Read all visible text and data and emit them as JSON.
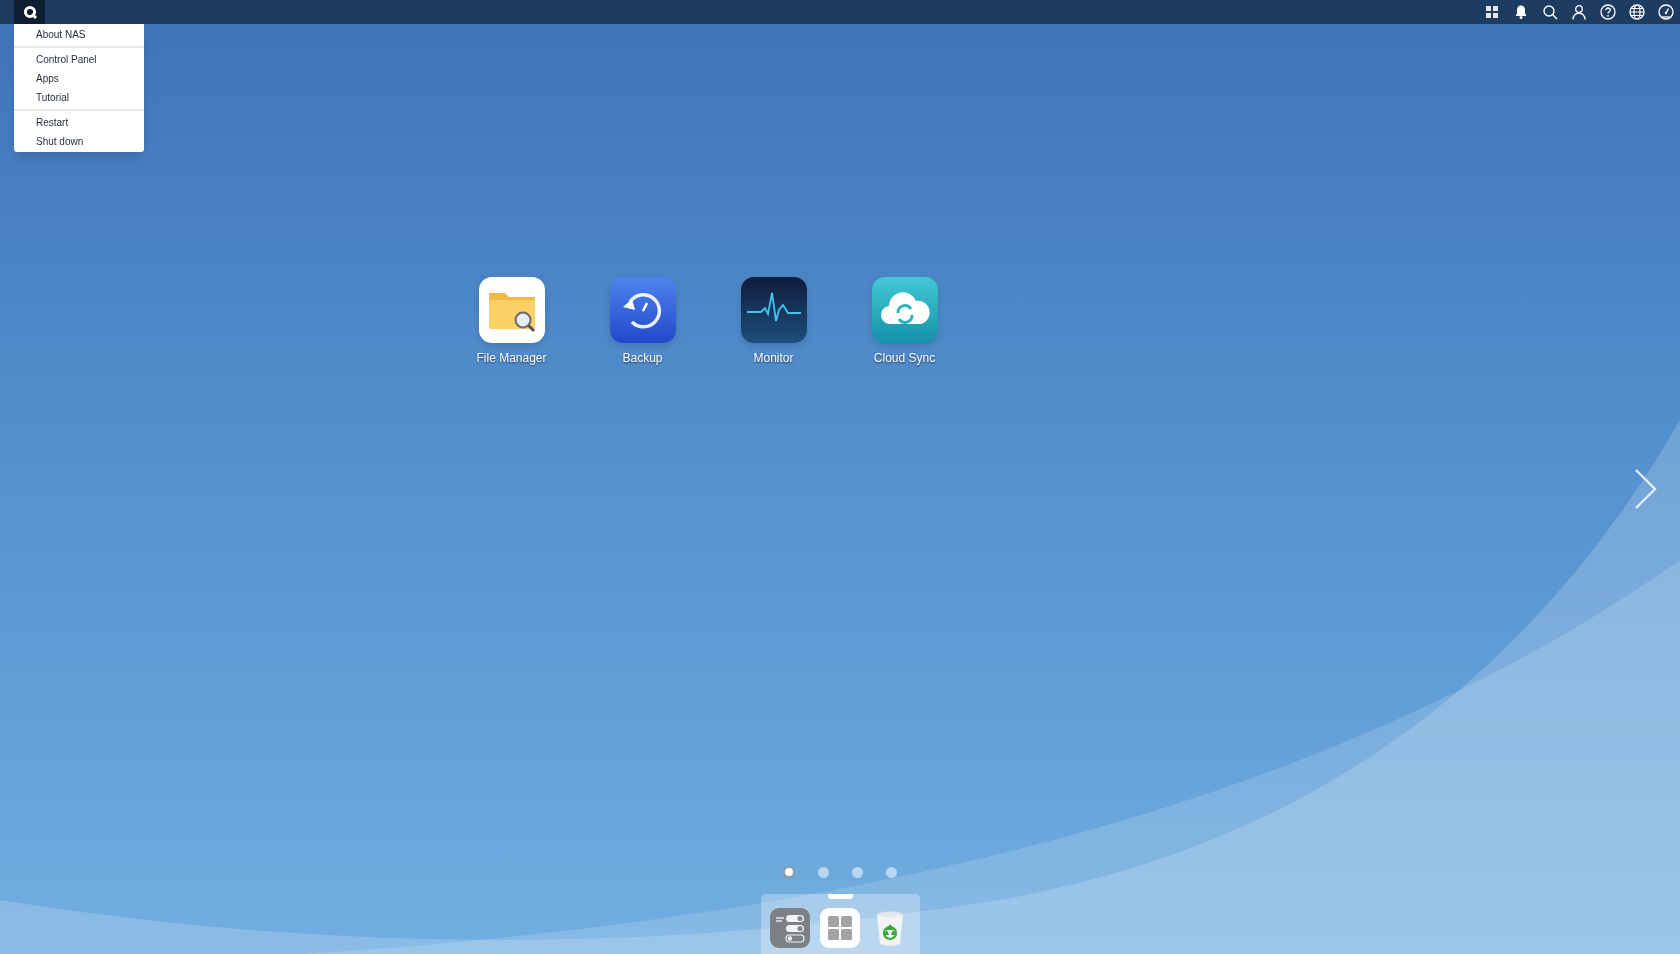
{
  "start_menu": {
    "open": true,
    "sections": [
      {
        "items": [
          "About NAS"
        ]
      },
      {
        "items": [
          "Control Panel",
          "Apps",
          "Tutorial"
        ]
      },
      {
        "items": [
          "Restart",
          "Shut down"
        ]
      }
    ]
  },
  "desktop_apps": [
    {
      "label": "File Manager"
    },
    {
      "label": "Backup"
    },
    {
      "label": "Monitor"
    },
    {
      "label": "Cloud Sync"
    }
  ],
  "page_dots": [
    {
      "selected": true
    },
    {
      "selected": false
    },
    {
      "selected": false
    },
    {
      "selected": false
    }
  ]
}
